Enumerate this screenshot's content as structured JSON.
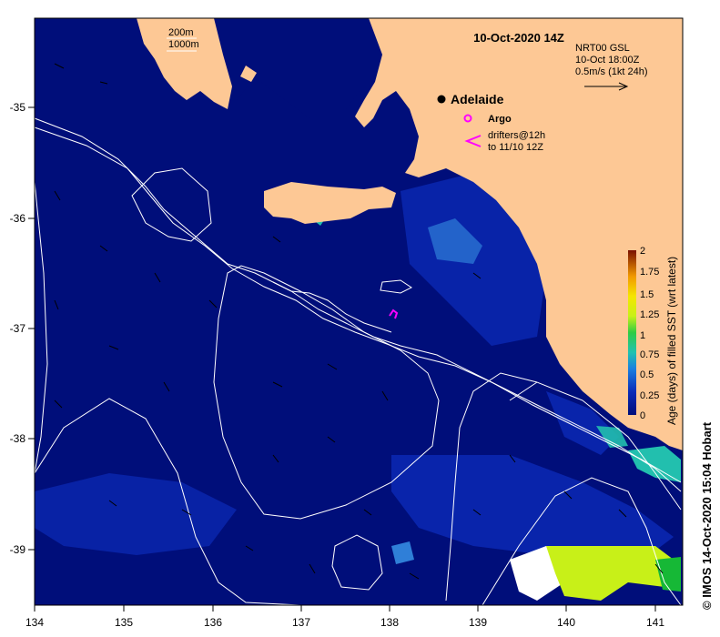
{
  "map": {
    "title": "10-Oct-2020 14Z",
    "bathymetry_legend": [
      "200m",
      "1000m"
    ],
    "current_legend": [
      "NRT00 GSL",
      "10-Oct 18:00Z",
      "0.5m/s (1kt 24h)"
    ],
    "city": "Adelaide",
    "argo_label": "Argo",
    "drifters_label": [
      "drifters@12h",
      "to 11/10 12Z"
    ],
    "credit": "© IMOS 14-Oct-2020 15:04 Hobart",
    "colorbar_label": "Age (days) of filled SST (wrt latest)",
    "colorbar_ticks": [
      "2",
      "1.75",
      "1.5",
      "1.25",
      "1",
      "0.75",
      "0.5",
      "0.25",
      "0"
    ],
    "lon_ticks": [
      "134",
      "135",
      "136",
      "137",
      "138",
      "139",
      "140",
      "141"
    ],
    "lat_ticks": [
      "-35",
      "-36",
      "-37",
      "-38",
      "-39"
    ],
    "colors": {
      "ocean": "#000e7a",
      "land": "#fdc895",
      "argo": "#ff00ff",
      "drifter": "#ff00ff",
      "contour": "#ffffff",
      "age_low": "#0b2bb8",
      "age_mid": "#2f7fd8",
      "age_teal": "#22bfae",
      "age_green": "#c8f018",
      "age_bright_green": "#16b836"
    }
  }
}
